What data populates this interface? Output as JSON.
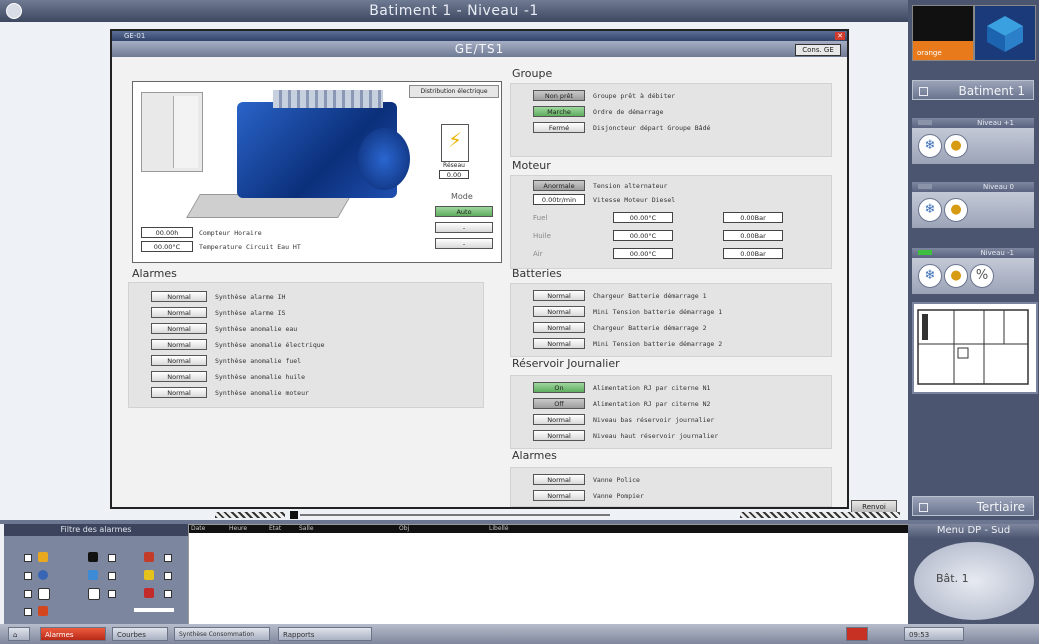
{
  "top_bar": {
    "title": "Batiment 1 - Niveau -1"
  },
  "window": {
    "tab_label": "GE-01",
    "title": "GE/TS1",
    "top_right_button": "Cons. GE",
    "electrical_button": "Distribution électrique",
    "bolt_caption": "Réseau",
    "bolt_value": "0.00",
    "mode": {
      "title": "Mode",
      "auto": "Auto",
      "b2": "-",
      "b3": "-"
    },
    "counters": [
      {
        "value": "00.00h",
        "label": "Compteur Horaire"
      },
      {
        "value": "00.00°C",
        "label": "Temperature Circuit Eau HT"
      }
    ]
  },
  "alarmes_left": {
    "title": "Alarmes",
    "rows": [
      {
        "state": "Normal",
        "label": "Synthèse alarme IH"
      },
      {
        "state": "Normal",
        "label": "Synthèse alarme IS"
      },
      {
        "state": "Normal",
        "label": "Synthèse anomalie eau"
      },
      {
        "state": "Normal",
        "label": "Synthèse anomalie électrique"
      },
      {
        "state": "Normal",
        "label": "Synthèse anomalie fuel"
      },
      {
        "state": "Normal",
        "label": "Synthèse anomalie huile"
      },
      {
        "state": "Normal",
        "label": "Synthèse anomalie moteur"
      }
    ]
  },
  "groupe": {
    "title": "Groupe",
    "rows": [
      {
        "state": "Non prêt",
        "label": "Groupe prêt à débiter"
      },
      {
        "state": "Marche",
        "label": "Ordre de démarrage"
      },
      {
        "state": "Fermé",
        "label": "Disjoncteur départ Groupe Bâdé"
      }
    ]
  },
  "moteur": {
    "title": "Moteur",
    "rows": [
      {
        "state": "Anormale",
        "label": "Tension alternateur"
      },
      {
        "state": "0.00tr/min",
        "label": "Vitesse Moteur Diesel"
      }
    ],
    "grid": [
      {
        "label": "Fuel",
        "t": "00.00°C",
        "p": "0.00Bar"
      },
      {
        "label": "Huile",
        "t": "00.00°C",
        "p": "0.00Bar"
      },
      {
        "label": "Air",
        "t": "00.00°C",
        "p": "0.00Bar"
      }
    ]
  },
  "batteries": {
    "title": "Batteries",
    "rows": [
      {
        "state": "Normal",
        "label": "Chargeur Batterie démarrage 1"
      },
      {
        "state": "Normal",
        "label": "Mini Tension batterie démarrage 1"
      },
      {
        "state": "Normal",
        "label": "Chargeur Batterie démarrage 2"
      },
      {
        "state": "Normal",
        "label": "Mini Tension batterie démarrage 2"
      }
    ]
  },
  "reservoir": {
    "title": "Réservoir Journalier",
    "rows": [
      {
        "state": "On",
        "label": "Alimentation RJ par citerne N1"
      },
      {
        "state": "Off",
        "label": "Alimentation RJ par citerne N2"
      },
      {
        "state": "Normal",
        "label": "Niveau bas réservoir journalier"
      },
      {
        "state": "Normal",
        "label": "Niveau haut réservoir journalier"
      }
    ]
  },
  "alarmes_right": {
    "title": "Alarmes",
    "rows": [
      {
        "state": "Normal",
        "label": "Vanne Police"
      },
      {
        "state": "Normal",
        "label": "Vanne Pompier"
      }
    ]
  },
  "right_panel": {
    "logo_text": "orange",
    "building_button": "Batiment 1",
    "levels": [
      {
        "title": "Niveau +1"
      },
      {
        "title": "Niveau 0"
      },
      {
        "title": "Niveau -1"
      }
    ],
    "tertiaire_button": "Tertiaire",
    "renvoi_button": "Renvoi"
  },
  "filter_panel": {
    "title": "Filtre des alarmes"
  },
  "event_log": {
    "headers": [
      "Date",
      "Heure",
      "Etat",
      "Salle",
      "Obj",
      "Libellé"
    ]
  },
  "menu_panel": {
    "title": "Menu DP - Sud",
    "oval_label": "Bât. 1"
  },
  "taskbar": {
    "items": [
      "Alarmes",
      "Courbes",
      "Synthèse Consommation",
      "Rapports"
    ],
    "clock": "09:53"
  }
}
